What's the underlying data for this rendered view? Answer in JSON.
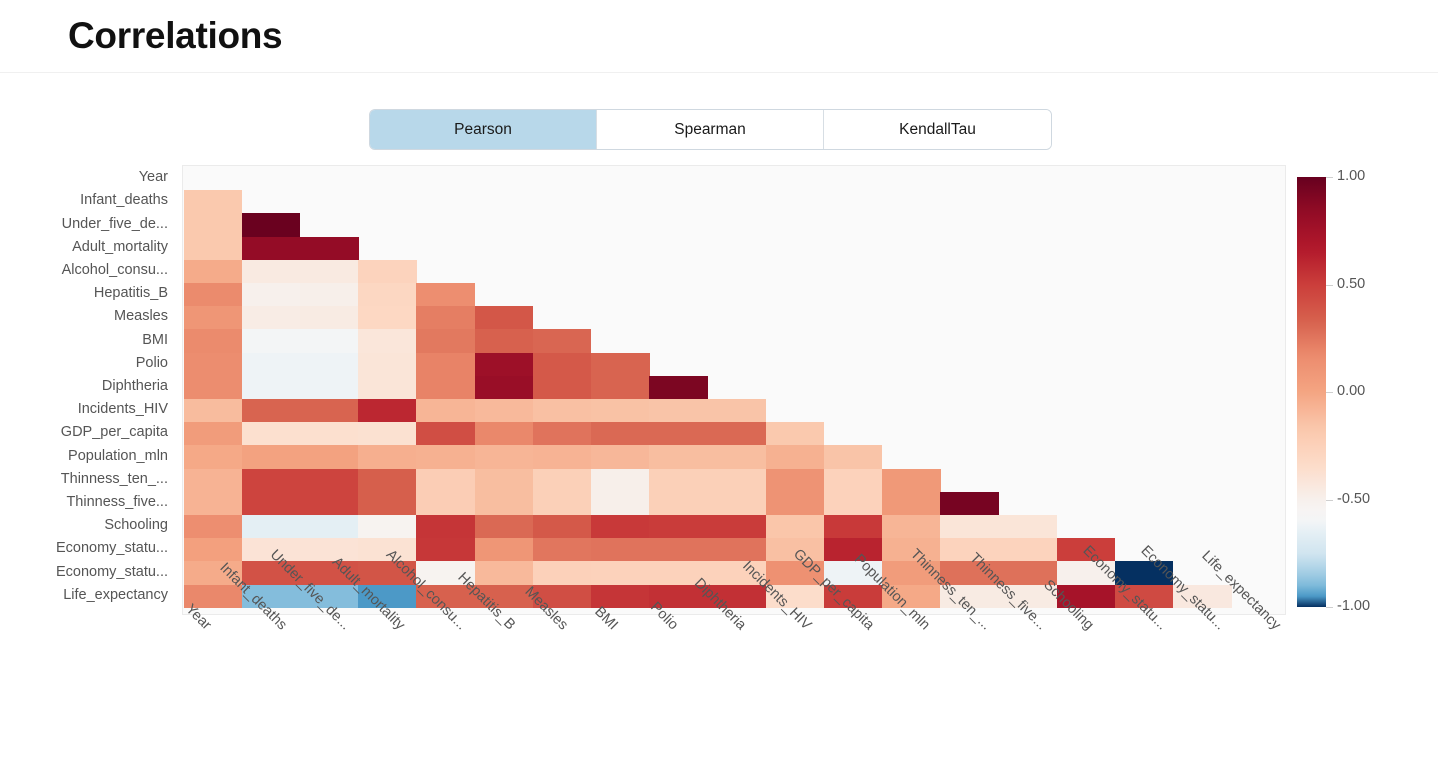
{
  "header": {
    "title": "Correlations"
  },
  "tabs": {
    "items": [
      {
        "label": "Pearson",
        "active": true
      },
      {
        "label": "Spearman",
        "active": false
      },
      {
        "label": "KendallTau",
        "active": false
      }
    ]
  },
  "colorbar": {
    "ticks": [
      "1.00",
      "0.50",
      "0.00",
      "-0.50",
      "-1.00"
    ],
    "tick_values": [
      1.0,
      0.5,
      0.0,
      -0.5,
      -1.0
    ],
    "vmin": -1.0,
    "vmax": 1.0,
    "colormap": "RdBu_r",
    "top_color": "#67001f",
    "mid_color": "#f7f7f7",
    "bottom_color": "#053061"
  },
  "chart_data": {
    "type": "heatmap",
    "title": "Correlations",
    "xlabel": "",
    "ylabel": "",
    "method": "Pearson",
    "triangle": "lower",
    "zmin": -1.0,
    "zmax": 1.0,
    "grid": false,
    "legend_position": "right",
    "categories": [
      "Year",
      "Infant_deaths",
      "Under_five_de...",
      "Adult_mortality",
      "Alcohol_consu...",
      "Hepatitis_B",
      "Measles",
      "BMI",
      "Polio",
      "Diphtheria",
      "Incidents_HIV",
      "GDP_per_capita",
      "Population_mln",
      "Thinness_ten_...",
      "Thinness_five...",
      "Schooling",
      "Economy_statu...",
      "Economy_statu...",
      "Life_expectancy"
    ],
    "x": [
      "Year",
      "Infant_deaths",
      "Under_five_de...",
      "Adult_mortality",
      "Alcohol_consu...",
      "Hepatitis_B",
      "Measles",
      "BMI",
      "Polio",
      "Diphtheria",
      "Incidents_HIV",
      "GDP_per_capita",
      "Population_mln",
      "Thinness_ten_...",
      "Thinness_five...",
      "Schooling",
      "Economy_statu...",
      "Economy_statu...",
      "Life_expectancy"
    ],
    "y": [
      "Year",
      "Infant_deaths",
      "Under_five_de...",
      "Adult_mortality",
      "Alcohol_consu...",
      "Hepatitis_B",
      "Measles",
      "BMI",
      "Polio",
      "Diphtheria",
      "Incidents_HIV",
      "GDP_per_capita",
      "Population_mln",
      "Thinness_ten_...",
      "Thinness_five...",
      "Schooling",
      "Economy_statu...",
      "Economy_statu...",
      "Life_expectancy"
    ],
    "z": [
      [
        null,
        null,
        null,
        null,
        null,
        null,
        null,
        null,
        null,
        null,
        null,
        null,
        null,
        null,
        null,
        null,
        null,
        null,
        null
      ],
      [
        -0.18,
        null,
        null,
        null,
        null,
        null,
        null,
        null,
        null,
        null,
        null,
        null,
        null,
        null,
        null,
        null,
        null,
        null,
        null
      ],
      [
        -0.18,
        0.99,
        null,
        null,
        null,
        null,
        null,
        null,
        null,
        null,
        null,
        null,
        null,
        null,
        null,
        null,
        null,
        null,
        null
      ],
      [
        -0.18,
        0.83,
        0.83,
        null,
        null,
        null,
        null,
        null,
        null,
        null,
        null,
        null,
        null,
        null,
        null,
        null,
        null,
        null,
        null
      ],
      [
        -0.03,
        -0.45,
        -0.45,
        -0.27,
        null,
        null,
        null,
        null,
        null,
        null,
        null,
        null,
        null,
        null,
        null,
        null,
        null,
        null,
        null
      ],
      [
        0.17,
        -0.5,
        -0.49,
        -0.3,
        0.15,
        null,
        null,
        null,
        null,
        null,
        null,
        null,
        null,
        null,
        null,
        null,
        null,
        null,
        null
      ],
      [
        0.1,
        -0.47,
        -0.46,
        -0.31,
        0.22,
        0.38,
        null,
        null,
        null,
        null,
        null,
        null,
        null,
        null,
        null,
        null,
        null,
        null,
        null
      ],
      [
        0.17,
        -0.6,
        -0.6,
        -0.42,
        0.24,
        0.33,
        0.31,
        null,
        null,
        null,
        null,
        null,
        null,
        null,
        null,
        null,
        null,
        null,
        null
      ],
      [
        0.16,
        -0.62,
        -0.62,
        -0.41,
        0.2,
        0.78,
        0.37,
        0.32,
        null,
        null,
        null,
        null,
        null,
        null,
        null,
        null,
        null,
        null,
        null
      ],
      [
        0.16,
        -0.62,
        -0.62,
        -0.41,
        0.2,
        0.8,
        0.37,
        0.32,
        0.92,
        null,
        null,
        null,
        null,
        null,
        null,
        null,
        null,
        null,
        null
      ],
      [
        -0.11,
        0.32,
        0.32,
        0.6,
        -0.08,
        -0.1,
        -0.13,
        -0.14,
        -0.15,
        -0.15,
        null,
        null,
        null,
        null,
        null,
        null,
        null,
        null,
        null
      ],
      [
        0.06,
        -0.37,
        -0.37,
        -0.38,
        0.42,
        0.18,
        0.26,
        0.3,
        0.3,
        0.3,
        -0.18,
        null,
        null,
        null,
        null,
        null,
        null,
        null,
        null
      ],
      [
        -0.02,
        0.02,
        0.02,
        -0.05,
        -0.06,
        -0.08,
        -0.07,
        -0.09,
        -0.12,
        -0.12,
        -0.06,
        -0.15,
        null,
        null,
        null,
        null,
        null,
        null,
        null
      ],
      [
        -0.07,
        0.47,
        0.47,
        0.34,
        -0.22,
        -0.12,
        -0.24,
        -0.49,
        -0.24,
        -0.24,
        0.12,
        -0.26,
        0.08,
        null,
        null,
        null,
        null,
        null,
        null
      ],
      [
        -0.07,
        0.47,
        0.47,
        0.34,
        -0.22,
        -0.12,
        -0.24,
        -0.49,
        -0.24,
        -0.24,
        0.12,
        -0.26,
        0.08,
        0.94,
        null,
        null,
        null,
        null,
        null
      ],
      [
        0.15,
        -0.66,
        -0.66,
        -0.53,
        0.54,
        0.3,
        0.37,
        0.52,
        0.51,
        0.51,
        -0.16,
        0.52,
        -0.08,
        -0.41,
        -0.41,
        null,
        null,
        null,
        null
      ],
      [
        0.03,
        -0.4,
        -0.4,
        -0.39,
        0.53,
        0.1,
        0.25,
        0.26,
        0.26,
        0.26,
        -0.13,
        0.62,
        -0.06,
        -0.27,
        -0.27,
        0.5,
        null,
        null,
        null
      ],
      [
        -0.03,
        0.4,
        0.4,
        0.39,
        -0.53,
        -0.1,
        -0.25,
        -0.26,
        -0.26,
        -0.26,
        0.13,
        -0.62,
        0.06,
        0.27,
        0.27,
        -0.5,
        -1.0,
        null,
        null
      ],
      [
        0.18,
        -0.89,
        -0.89,
        -0.95,
        0.33,
        0.33,
        0.42,
        0.54,
        0.56,
        0.56,
        -0.35,
        0.51,
        -0.02,
        -0.46,
        -0.46,
        0.73,
        0.44,
        -0.44,
        null
      ]
    ]
  }
}
